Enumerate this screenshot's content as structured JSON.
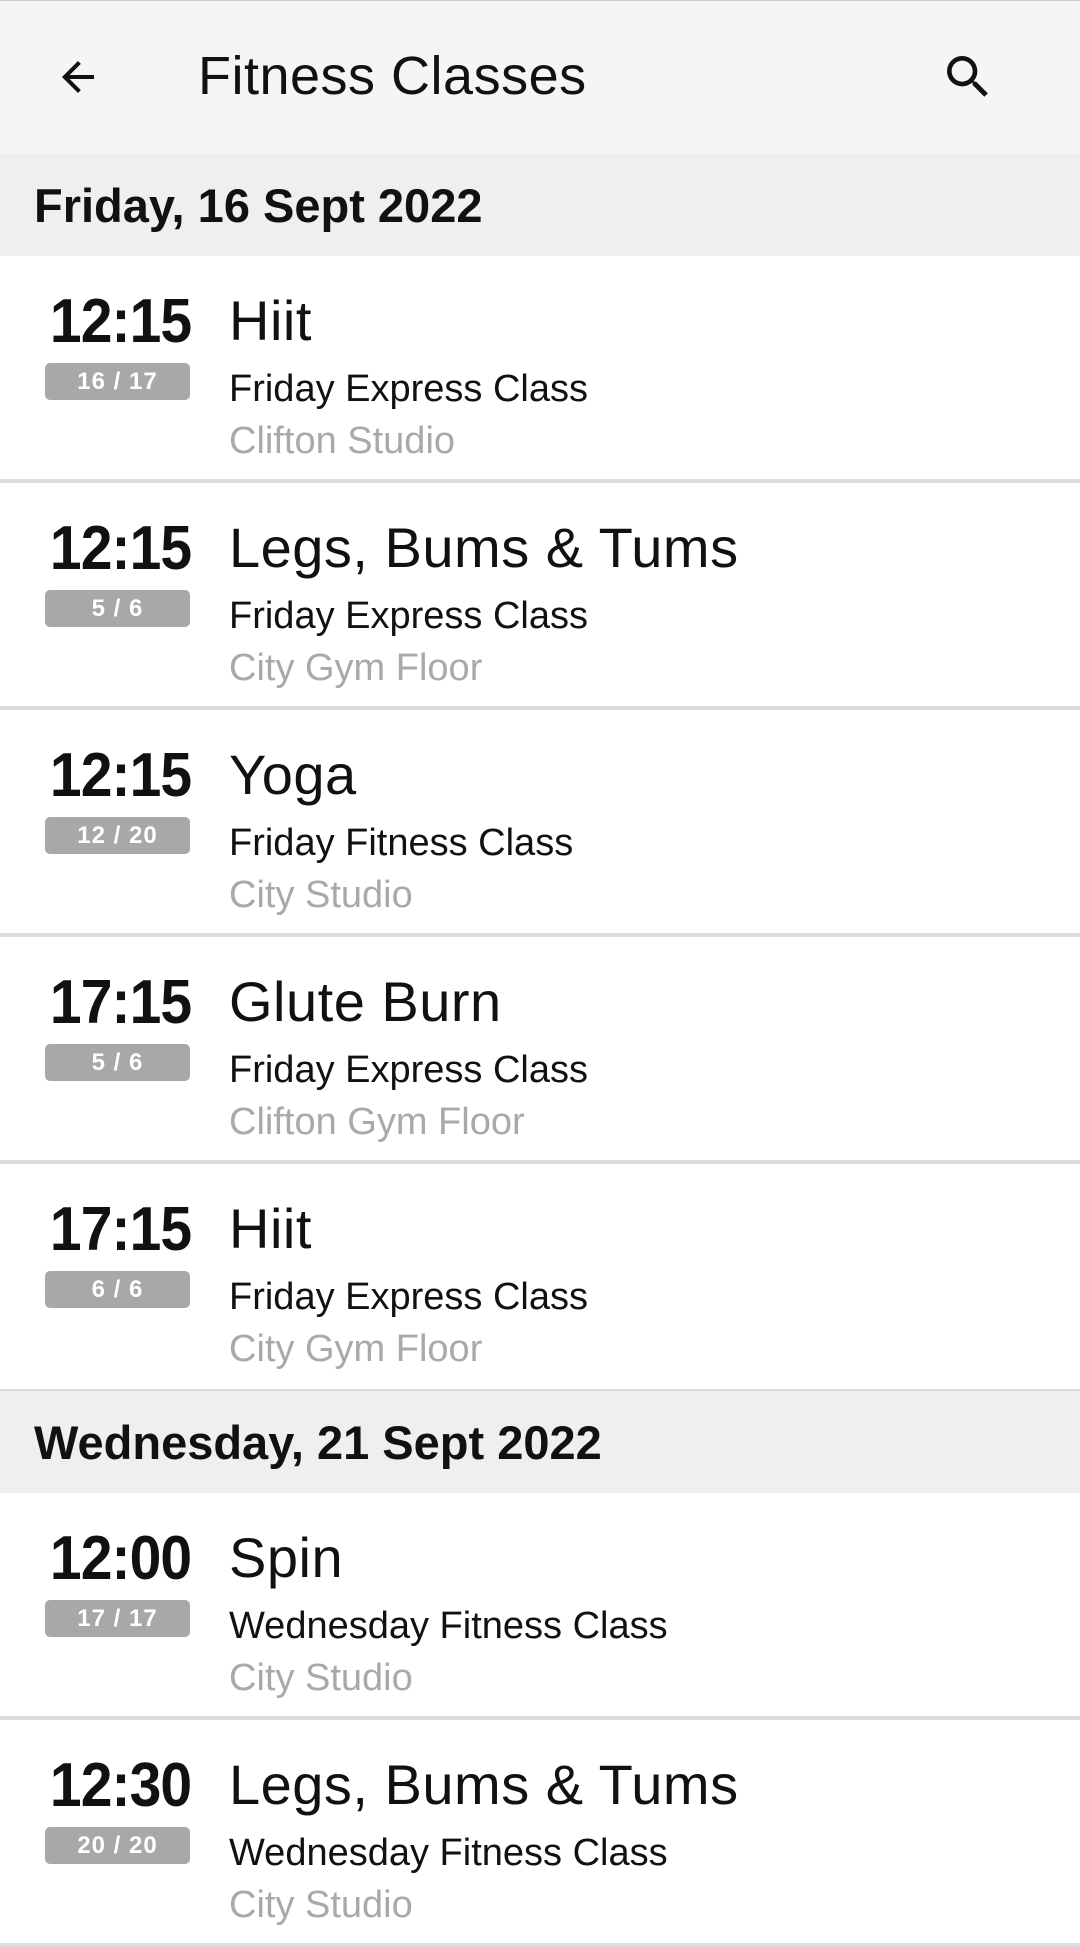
{
  "header": {
    "title": "Fitness Classes",
    "back_icon": "arrow-left-icon",
    "search_icon": "search-icon"
  },
  "colors": {
    "header_bg": "#f5f4f6",
    "day_header_bg": "#efeef1",
    "badge_bg": "#a8a8aa",
    "location_text": "#a9a9ab"
  },
  "days": [
    {
      "date": "Friday, 16 Sept 2022",
      "classes": [
        {
          "time": "12:15",
          "capacity": "16 / 17",
          "name": "Hiit",
          "type": "Friday Express Class",
          "location": "Clifton Studio"
        },
        {
          "time": "12:15",
          "capacity": "5 / 6",
          "name": "Legs, Bums & Tums",
          "type": "Friday Express Class",
          "location": "City Gym Floor"
        },
        {
          "time": "12:15",
          "capacity": "12 / 20",
          "name": "Yoga",
          "type": "Friday Fitness Class",
          "location": "City Studio"
        },
        {
          "time": "17:15",
          "capacity": "5 / 6",
          "name": "Glute Burn",
          "type": "Friday Express Class",
          "location": "Clifton Gym Floor"
        },
        {
          "time": "17:15",
          "capacity": "6 / 6",
          "name": "Hiit",
          "type": "Friday Express Class",
          "location": "City Gym Floor"
        }
      ]
    },
    {
      "date": "Wednesday, 21 Sept 2022",
      "classes": [
        {
          "time": "12:00",
          "capacity": "17 / 17",
          "name": "Spin",
          "type": "Wednesday Fitness Class",
          "location": "City Studio"
        },
        {
          "time": "12:30",
          "capacity": "20 / 20",
          "name": "Legs, Bums & Tums",
          "type": "Wednesday Fitness Class",
          "location": "City Studio"
        }
      ]
    }
  ]
}
